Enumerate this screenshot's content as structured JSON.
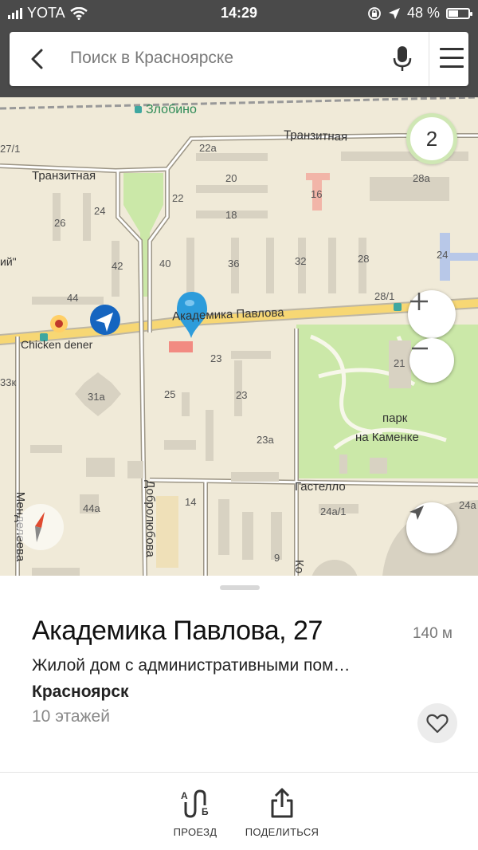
{
  "status_bar": {
    "carrier": "YOTA",
    "time": "14:29",
    "battery": "48 %",
    "battery_level": 0.48,
    "icons": [
      "signal-icon",
      "wifi-icon",
      "orientation-lock-icon",
      "location-arrow-icon",
      "battery-icon"
    ]
  },
  "search": {
    "placeholder": "Поиск в Красноярске",
    "icons": [
      "back-arrow-icon",
      "microphone-icon",
      "menu-icon"
    ]
  },
  "map": {
    "labels": {
      "zlobino": "Злобино",
      "tranzitnaya_1": "Транзитная",
      "tranzitnaya_2": "Транзитная",
      "akad_pavlova": "Академика Павлова",
      "chicken": "Chicken dener",
      "park_1": "парк",
      "park_2": "на Каменке",
      "gastello": "Гастелло",
      "mendeleeva": "Менделеева",
      "dobrolyubova": "Добролюбова",
      "ko": "Ко",
      "partial_quote": "ий\"",
      "b22a": "22а",
      "b20": "20",
      "b16": "16",
      "b18": "18",
      "b28a": "28а",
      "b24l": "24",
      "b26": "26",
      "b22": "22",
      "b42": "42",
      "b40": "40",
      "b36": "36",
      "b32": "32",
      "b28": "28",
      "b24r": "24",
      "b44": "44",
      "b28_1": "28/1",
      "b21": "21",
      "b23a": "23",
      "b23b": "23",
      "b25": "25",
      "b31a": "31а",
      "b23a2": "23а",
      "b14": "14",
      "b24a1": "24а/1",
      "b24a": "24а",
      "b44a": "44а",
      "b9": "9",
      "b27_1": "27/1",
      "b33": "33к"
    },
    "cluster_count": "2",
    "controls": [
      "zoom-in-button",
      "zoom-out-button",
      "locate-button",
      "compass-button"
    ],
    "colors": {
      "road": "#f7d774",
      "park": "#cbe8a8",
      "ground": "#f0ead8",
      "pin": "#2d9cdb",
      "route_arrow": "#1565c0"
    }
  },
  "card": {
    "title": "Академика Павлова, 27",
    "distance": "140 м",
    "description": "Жилой дом с административными пом…",
    "city": "Красноярск",
    "floors": "10 этажей"
  },
  "actions": {
    "route": "ПРОЕЗД",
    "share": "ПОДЕЛИТЬСЯ"
  }
}
